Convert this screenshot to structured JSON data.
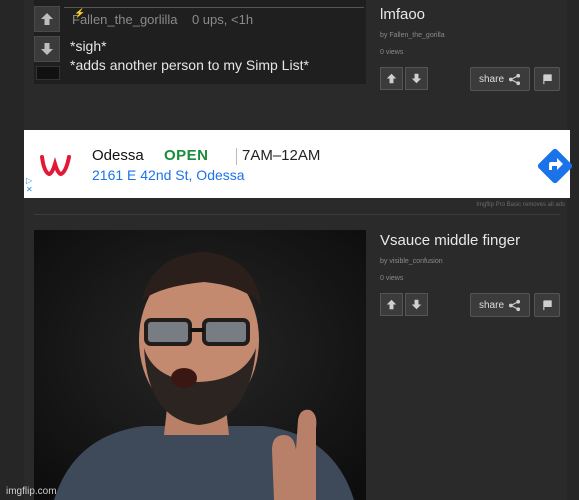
{
  "comment": {
    "username": "Fallen_the_gorlilla",
    "ups": "0 ups, <1h",
    "line1": "*sigh*",
    "line2": "*adds another person to my Simp List*"
  },
  "post1": {
    "title": "lmfaoo",
    "by": "by Fallen_the_gorilla",
    "views": "0 views",
    "share_label": "share"
  },
  "ad": {
    "brand_letter": "W",
    "store_name": "Odessa",
    "status": "OPEN",
    "hours": "7AM–12AM",
    "address": "2161 E 42nd St, Odessa",
    "removes_note": "Imgflip Pro Basic removes all ads"
  },
  "post2": {
    "title": "Vsauce middle finger",
    "by": "by visible_confusion",
    "views": "0 views",
    "share_label": "share"
  },
  "watermark": "imgflip.com",
  "colors": {
    "ad_open": "#1a8c3a",
    "ad_address": "#1a73e8",
    "walgreens_red": "#e31837"
  }
}
